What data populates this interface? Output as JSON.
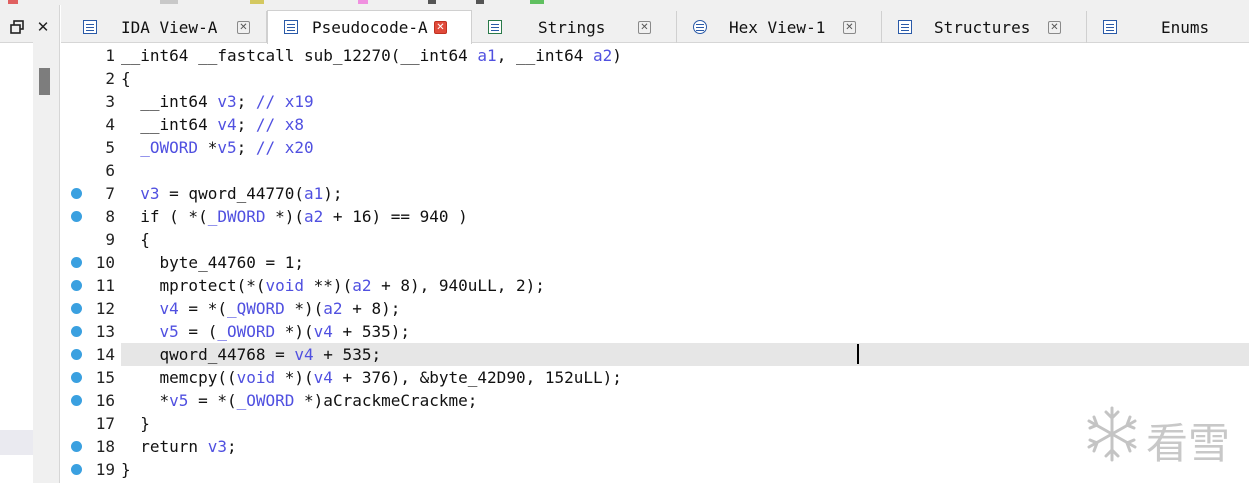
{
  "colors": {
    "strip": [
      "#e06060",
      "#c0c0c0",
      "#d4c860",
      "#f090e0",
      "#60c060"
    ],
    "breakpoint": "#3aa0e0",
    "variable": "#5050e0",
    "keyword": "#000080",
    "highlight": "#e6e6e6"
  },
  "left_panel": {
    "restore_icon": "restore-icon",
    "close_icon": "close-icon",
    "close_glyph": "✕",
    "restore_glyph": "🗗"
  },
  "tabs": [
    {
      "label": "IDA View-A",
      "icon": "graph-view-icon",
      "active": false
    },
    {
      "label": "Pseudocode-A",
      "icon": "pseudocode-icon",
      "active": true
    },
    {
      "label": "Strings",
      "icon": "strings-icon",
      "active": false
    },
    {
      "label": "Hex View-1",
      "icon": "hex-view-icon",
      "active": false
    },
    {
      "label": "Structures",
      "icon": "structures-icon",
      "active": false
    },
    {
      "label": "Enums",
      "icon": "enums-icon",
      "active": false
    }
  ],
  "code_lines": [
    {
      "n": "1",
      "bp": false,
      "text": "__int64 __fastcall sub_12270(__int64 a1, __int64 a2)"
    },
    {
      "n": "2",
      "bp": false,
      "text": "{"
    },
    {
      "n": "3",
      "bp": false,
      "text": "  __int64 v3; // x19"
    },
    {
      "n": "4",
      "bp": false,
      "text": "  __int64 v4; // x8"
    },
    {
      "n": "5",
      "bp": false,
      "text": "  _OWORD *v5; // x20"
    },
    {
      "n": "6",
      "bp": false,
      "text": ""
    },
    {
      "n": "7",
      "bp": true,
      "text": "  v3 = qword_44770(a1);"
    },
    {
      "n": "8",
      "bp": true,
      "text": "  if ( *(_DWORD *)(a2 + 16) == 940 )"
    },
    {
      "n": "9",
      "bp": false,
      "text": "  {"
    },
    {
      "n": "10",
      "bp": true,
      "text": "    byte_44760 = 1;"
    },
    {
      "n": "11",
      "bp": true,
      "text": "    mprotect(*(void **)(a2 + 8), 940uLL, 2);"
    },
    {
      "n": "12",
      "bp": true,
      "text": "    v4 = *(_QWORD *)(a2 + 8);"
    },
    {
      "n": "13",
      "bp": true,
      "text": "    v5 = (_OWORD *)(v4 + 535);"
    },
    {
      "n": "14",
      "bp": true,
      "text": "    qword_44768 = v4 + 535;"
    },
    {
      "n": "15",
      "bp": true,
      "text": "    memcpy((void *)(v4 + 376), &byte_42D90, 152uLL);"
    },
    {
      "n": "16",
      "bp": true,
      "text": "    *v5 = *(_OWORD *)aCrackmeCrackme;"
    },
    {
      "n": "17",
      "bp": false,
      "text": "  }"
    },
    {
      "n": "18",
      "bp": true,
      "text": "  return v3;"
    },
    {
      "n": "19",
      "bp": true,
      "text": "}"
    }
  ],
  "current_line": "14",
  "watermark": {
    "text": "看雪",
    "icon": "snowflake-icon"
  }
}
